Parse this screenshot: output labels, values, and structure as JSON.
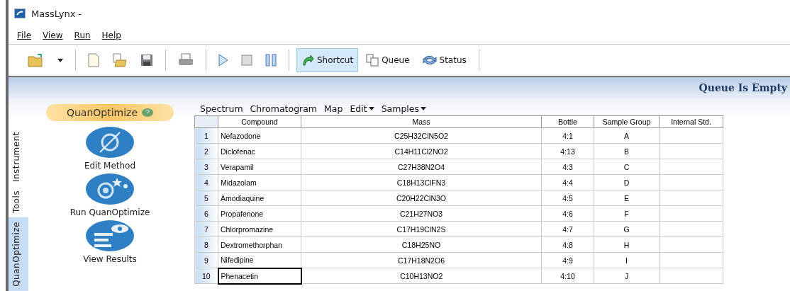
{
  "window": {
    "title": "MassLynx -"
  },
  "menu": [
    "File",
    "View",
    "Run",
    "Help"
  ],
  "toolbar": [
    {
      "kind": "open",
      "selected": false
    },
    {
      "kind": "dropdown",
      "selected": false
    },
    {
      "kind": "sep"
    },
    {
      "kind": "new",
      "selected": false
    },
    {
      "kind": "paste",
      "selected": false
    },
    {
      "kind": "save",
      "selected": false
    },
    {
      "kind": "sep"
    },
    {
      "kind": "print",
      "selected": false
    },
    {
      "kind": "sep"
    },
    {
      "kind": "play",
      "selected": false
    },
    {
      "kind": "stop",
      "selected": false
    },
    {
      "kind": "pause",
      "selected": false
    },
    {
      "kind": "sep"
    },
    {
      "kind": "shortcut",
      "label": "Shortcut",
      "selected": true
    },
    {
      "kind": "queue",
      "label": "Queue",
      "selected": false
    },
    {
      "kind": "status",
      "label": "Status",
      "selected": false
    },
    {
      "kind": "sep"
    }
  ],
  "banner": {
    "status": "Queue Is Empty"
  },
  "side_tabs": [
    {
      "label": "Instrument",
      "selected": false
    },
    {
      "label": "Tools",
      "selected": false
    },
    {
      "label": "QuanOptimize",
      "selected": true
    }
  ],
  "panel": {
    "title": "QuanOptimize",
    "actions": [
      {
        "kind": "edit",
        "label": "Edit Method"
      },
      {
        "kind": "run",
        "label": "Run QuanOptimize"
      },
      {
        "kind": "results",
        "label": "View Results"
      }
    ]
  },
  "table_menu": [
    {
      "label": "Spectrum",
      "dropdown": false
    },
    {
      "label": "Chromatogram",
      "dropdown": false
    },
    {
      "label": "Map",
      "dropdown": false
    },
    {
      "label": "Edit",
      "dropdown": true
    },
    {
      "label": "Samples",
      "dropdown": true
    }
  ],
  "table": {
    "columns": [
      "Compound",
      "Mass",
      "Bottle",
      "Sample Group",
      "Internal Std."
    ],
    "rows": [
      {
        "index": "1",
        "compound": "Nefazodone",
        "mass": "C25H32ClN5O2",
        "bottle": "4:1",
        "group": "A",
        "selected": false
      },
      {
        "index": "2",
        "compound": "Diclofenac",
        "mass": "C14H11Cl2NO2",
        "bottle": "4:13",
        "group": "B",
        "selected": false
      },
      {
        "index": "3",
        "compound": "Verapamil",
        "mass": "C27H38N2O4",
        "bottle": "4:3",
        "group": "C",
        "selected": false
      },
      {
        "index": "4",
        "compound": "Midazolam",
        "mass": "C18H13ClFN3",
        "bottle": "4:4",
        "group": "D",
        "selected": false
      },
      {
        "index": "5",
        "compound": "Amodiaquine",
        "mass": "C20H22ClN3O",
        "bottle": "4:5",
        "group": "E",
        "selected": false
      },
      {
        "index": "6",
        "compound": "Propafenone",
        "mass": "C21H27NO3",
        "bottle": "4:6",
        "group": "F",
        "selected": false
      },
      {
        "index": "7",
        "compound": "Chlorpromazine",
        "mass": "C17H19ClN2S",
        "bottle": "4:7",
        "group": "G",
        "selected": false
      },
      {
        "index": "8",
        "compound": "Dextromethorphan",
        "mass": "C18H25NO",
        "bottle": "4:8",
        "group": "H",
        "selected": false
      },
      {
        "index": "9",
        "compound": "Nifedipine",
        "mass": "C17H18N2O6",
        "bottle": "4:9",
        "group": "I",
        "selected": false
      },
      {
        "index": "10",
        "compound": "Phenacetin",
        "mass": "C10H13NO2",
        "bottle": "4:10",
        "group": "J",
        "selected": true
      }
    ]
  }
}
